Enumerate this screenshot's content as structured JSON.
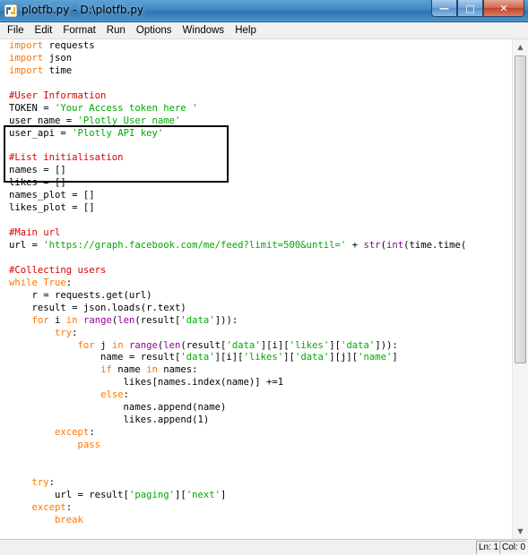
{
  "window": {
    "title": "plotfb.py - D:\\plotfb.py",
    "min_glyph": "—",
    "max_glyph": "□",
    "close_glyph": "✕"
  },
  "menu": [
    "File",
    "Edit",
    "Format",
    "Run",
    "Options",
    "Windows",
    "Help"
  ],
  "code_lines": [
    [
      {
        "t": "import",
        "c": "kw"
      },
      {
        "t": " requests"
      }
    ],
    [
      {
        "t": "import",
        "c": "kw"
      },
      {
        "t": " json"
      }
    ],
    [
      {
        "t": "import",
        "c": "kw"
      },
      {
        "t": " time"
      }
    ],
    [],
    [
      {
        "t": "#User Information",
        "c": "cm"
      }
    ],
    [
      {
        "t": "TOKEN = "
      },
      {
        "t": "'Your Access token here '",
        "c": "str"
      }
    ],
    [
      {
        "t": "user_name = "
      },
      {
        "t": "'Plotly User_name'",
        "c": "str"
      }
    ],
    [
      {
        "t": "user_api = "
      },
      {
        "t": "'Plotly API key'",
        "c": "str"
      }
    ],
    [],
    [
      {
        "t": "#List initialisation",
        "c": "cm"
      }
    ],
    [
      {
        "t": "names = []"
      }
    ],
    [
      {
        "t": "likes = []"
      }
    ],
    [
      {
        "t": "names_plot = []"
      }
    ],
    [
      {
        "t": "likes_plot = []"
      }
    ],
    [],
    [
      {
        "t": "#Main url",
        "c": "cm"
      }
    ],
    [
      {
        "t": "url = "
      },
      {
        "t": "'https://graph.facebook.com/me/feed?limit=500&until='",
        "c": "str"
      },
      {
        "t": " + "
      },
      {
        "t": "str",
        "c": "bi"
      },
      {
        "t": "("
      },
      {
        "t": "int",
        "c": "bi"
      },
      {
        "t": "(time.time("
      }
    ],
    [],
    [
      {
        "t": "#Collecting users",
        "c": "cm"
      }
    ],
    [
      {
        "t": "while",
        "c": "kw"
      },
      {
        "t": " "
      },
      {
        "t": "True",
        "c": "kw"
      },
      {
        "t": ":"
      }
    ],
    [
      {
        "t": "    r = requests.get(url)"
      }
    ],
    [
      {
        "t": "    result = json.loads(r.text)"
      }
    ],
    [
      {
        "t": "    "
      },
      {
        "t": "for",
        "c": "kw"
      },
      {
        "t": " i "
      },
      {
        "t": "in",
        "c": "kw"
      },
      {
        "t": " "
      },
      {
        "t": "range",
        "c": "bi"
      },
      {
        "t": "("
      },
      {
        "t": "len",
        "c": "bi"
      },
      {
        "t": "(result["
      },
      {
        "t": "'data'",
        "c": "str"
      },
      {
        "t": "])):"
      }
    ],
    [
      {
        "t": "        "
      },
      {
        "t": "try",
        "c": "kw"
      },
      {
        "t": ":"
      }
    ],
    [
      {
        "t": "            "
      },
      {
        "t": "for",
        "c": "kw"
      },
      {
        "t": " j "
      },
      {
        "t": "in",
        "c": "kw"
      },
      {
        "t": " "
      },
      {
        "t": "range",
        "c": "bi"
      },
      {
        "t": "("
      },
      {
        "t": "len",
        "c": "bi"
      },
      {
        "t": "(result["
      },
      {
        "t": "'data'",
        "c": "str"
      },
      {
        "t": "][i]["
      },
      {
        "t": "'likes'",
        "c": "str"
      },
      {
        "t": "]["
      },
      {
        "t": "'data'",
        "c": "str"
      },
      {
        "t": "])):"
      }
    ],
    [
      {
        "t": "                name = result["
      },
      {
        "t": "'data'",
        "c": "str"
      },
      {
        "t": "][i]["
      },
      {
        "t": "'likes'",
        "c": "str"
      },
      {
        "t": "]["
      },
      {
        "t": "'data'",
        "c": "str"
      },
      {
        "t": "][j]["
      },
      {
        "t": "'name'",
        "c": "str"
      },
      {
        "t": "]"
      }
    ],
    [
      {
        "t": "                "
      },
      {
        "t": "if",
        "c": "kw"
      },
      {
        "t": " name "
      },
      {
        "t": "in",
        "c": "kw"
      },
      {
        "t": " names:"
      }
    ],
    [
      {
        "t": "                    likes[names.index(name)] +=1"
      }
    ],
    [
      {
        "t": "                "
      },
      {
        "t": "else",
        "c": "kw"
      },
      {
        "t": ":"
      }
    ],
    [
      {
        "t": "                    names.append(name)"
      }
    ],
    [
      {
        "t": "                    likes.append(1)"
      }
    ],
    [
      {
        "t": "        "
      },
      {
        "t": "except",
        "c": "kw"
      },
      {
        "t": ":"
      }
    ],
    [
      {
        "t": "            "
      },
      {
        "t": "pass",
        "c": "kw"
      }
    ],
    [],
    [],
    [
      {
        "t": "    "
      },
      {
        "t": "try",
        "c": "kw"
      },
      {
        "t": ":"
      }
    ],
    [
      {
        "t": "        url = result["
      },
      {
        "t": "'paging'",
        "c": "str"
      },
      {
        "t": "]["
      },
      {
        "t": "'next'",
        "c": "str"
      },
      {
        "t": "]"
      }
    ],
    [
      {
        "t": "    "
      },
      {
        "t": "except",
        "c": "kw"
      },
      {
        "t": ":"
      }
    ],
    [
      {
        "t": "        "
      },
      {
        "t": "break",
        "c": "kw"
      }
    ]
  ],
  "status": {
    "line": "Ln: 1",
    "col": "Col: 0"
  }
}
